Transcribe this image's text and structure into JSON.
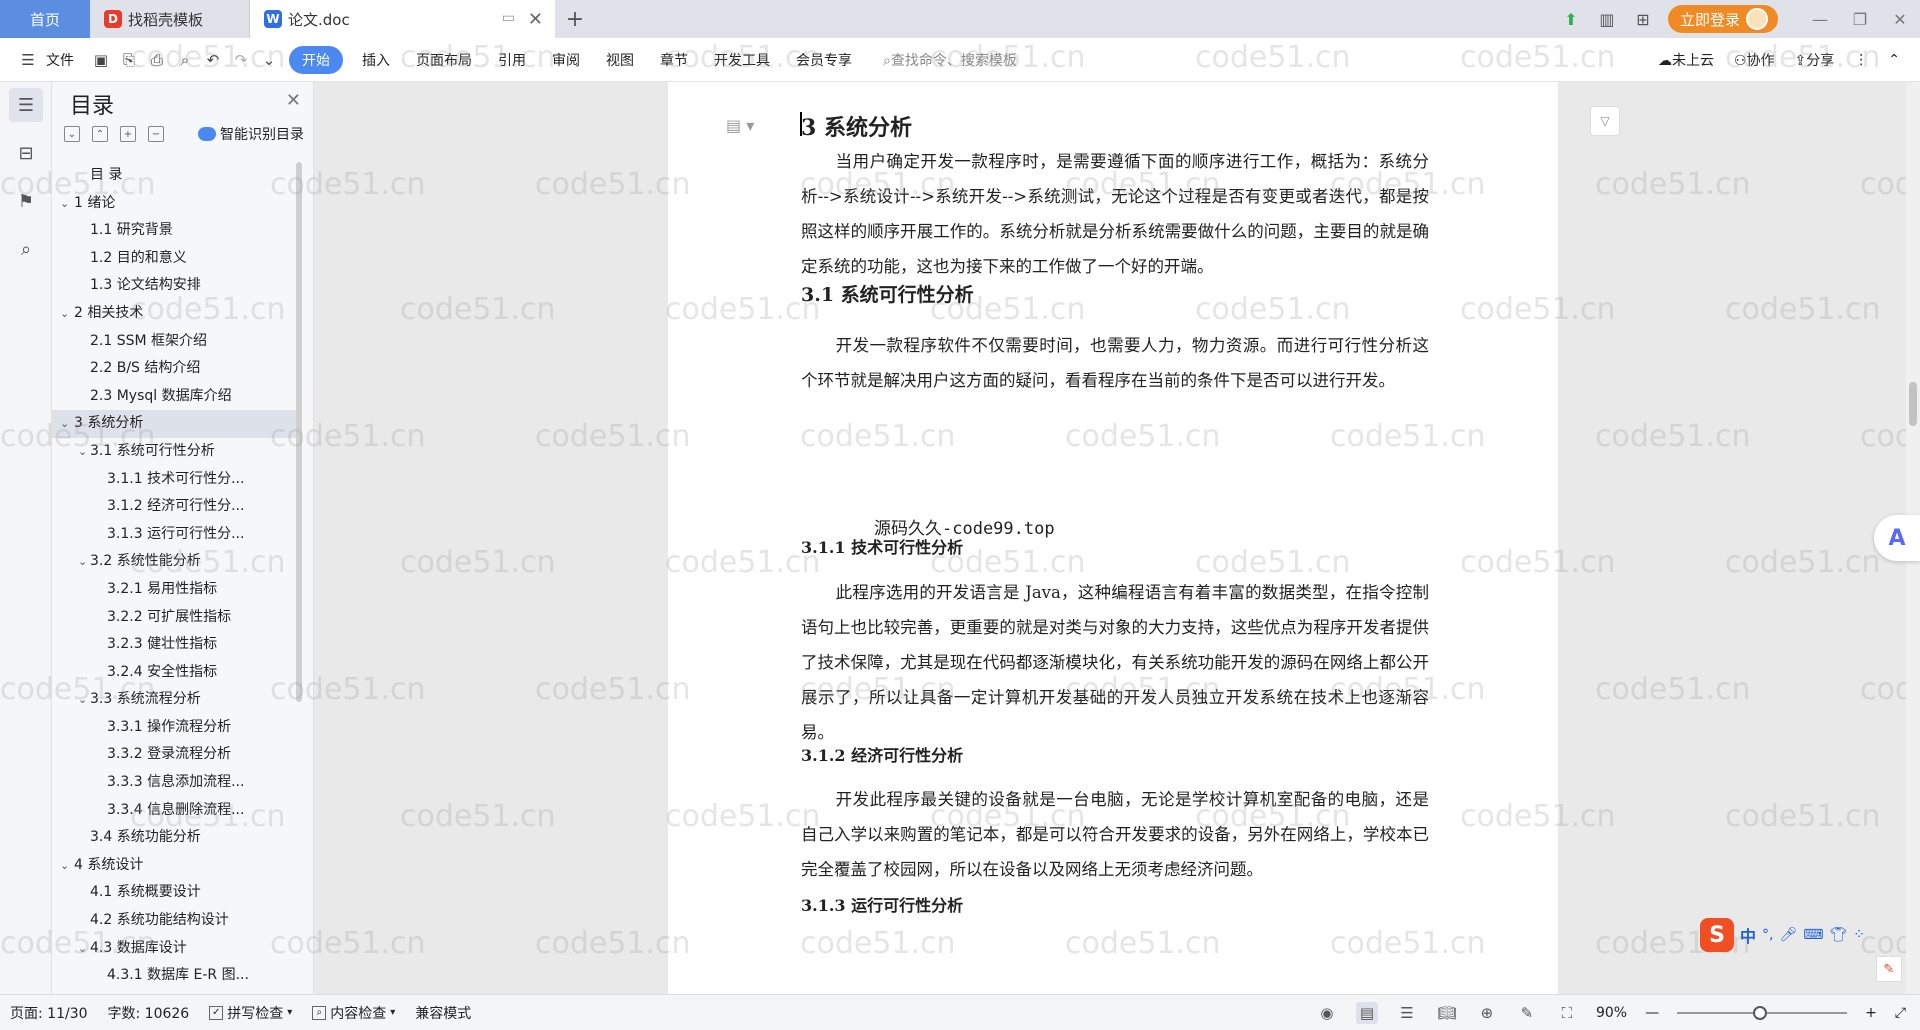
{
  "tabs": {
    "home": "首页",
    "template": "找稻壳模板",
    "doc": "论文.doc",
    "new_tab": "+"
  },
  "titlebar": {
    "login": "立即登录"
  },
  "menu": {
    "file": "文件",
    "items": [
      "开始",
      "插入",
      "页面布局",
      "引用",
      "审阅",
      "视图",
      "章节",
      "开发工具",
      "会员专享"
    ],
    "search_placeholder": "查找命令、搜索模板",
    "cloud": "未上云",
    "collab": "协作",
    "share": "分享"
  },
  "toc": {
    "title": "目录",
    "smart": "智能识别目录",
    "items": [
      {
        "text": "目 录",
        "level": 0,
        "arrow": ""
      },
      {
        "text": "1 绪论",
        "level": 1,
        "arrow": "v"
      },
      {
        "text": "1.1 研究背景",
        "level": 2,
        "arrow": ""
      },
      {
        "text": "1.2 目的和意义",
        "level": 2,
        "arrow": ""
      },
      {
        "text": "1.3 论文结构安排",
        "level": 2,
        "arrow": ""
      },
      {
        "text": "2 相关技术",
        "level": 1,
        "arrow": "v"
      },
      {
        "text": "2.1 SSM 框架介绍",
        "level": 2,
        "arrow": ""
      },
      {
        "text": "2.2 B/S 结构介绍",
        "level": 2,
        "arrow": ""
      },
      {
        "text": "2.3 Mysql 数据库介绍",
        "level": 2,
        "arrow": ""
      },
      {
        "text": "3 系统分析",
        "level": 1,
        "arrow": "v",
        "selected": true
      },
      {
        "text": "3.1 系统可行性分析",
        "level": 2,
        "arrow": "v"
      },
      {
        "text": "3.1.1 技术可行性分...",
        "level": 3,
        "arrow": ""
      },
      {
        "text": "3.1.2 经济可行性分...",
        "level": 3,
        "arrow": ""
      },
      {
        "text": "3.1.3 运行可行性分...",
        "level": 3,
        "arrow": ""
      },
      {
        "text": "3.2 系统性能分析",
        "level": 2,
        "arrow": "v"
      },
      {
        "text": "3.2.1 易用性指标",
        "level": 3,
        "arrow": ""
      },
      {
        "text": "3.2.2 可扩展性指标",
        "level": 3,
        "arrow": ""
      },
      {
        "text": "3.2.3 健壮性指标",
        "level": 3,
        "arrow": ""
      },
      {
        "text": "3.2.4 安全性指标",
        "level": 3,
        "arrow": ""
      },
      {
        "text": "3.3 系统流程分析",
        "level": 2,
        "arrow": "v"
      },
      {
        "text": "3.3.1 操作流程分析",
        "level": 3,
        "arrow": ""
      },
      {
        "text": "3.3.2 登录流程分析",
        "level": 3,
        "arrow": ""
      },
      {
        "text": "3.3.3 信息添加流程...",
        "level": 3,
        "arrow": ""
      },
      {
        "text": "3.3.4 信息删除流程...",
        "level": 3,
        "arrow": ""
      },
      {
        "text": "3.4 系统功能分析",
        "level": 2,
        "arrow": ""
      },
      {
        "text": "4 系统设计",
        "level": 1,
        "arrow": "v"
      },
      {
        "text": "4.1 系统概要设计",
        "level": 2,
        "arrow": ""
      },
      {
        "text": "4.2 系统功能结构设计",
        "level": 2,
        "arrow": ""
      },
      {
        "text": "4.3 数据库设计",
        "level": 2,
        "arrow": "v"
      },
      {
        "text": "4.3.1 数据库 E-R 图...",
        "level": 3,
        "arrow": ""
      }
    ]
  },
  "document": {
    "h1": "3  系统分析",
    "p1": "当用户确定开发一款程序时，是需要遵循下面的顺序进行工作，概括为：系统分析-->系统设计-->系统开发-->系统测试，无论这个过程是否有变更或者迭代，都是按照这样的顺序开展工作的。系统分析就是分析系统需要做什么的问题，主要目的就是确定系统的功能，这也为接下来的工作做了一个好的开端。",
    "h2_1": "3.1  系统可行性分析",
    "p2": "开发一款程序软件不仅需要时间，也需要人力，物力资源。而进行可行性分析这个环节就是解决用户这方面的疑问，看看程序在当前的条件下是否可以进行开发。",
    "overlay": "源码久久-code99.top",
    "h3_1": "3.1.1  技术可行性分析",
    "p3": "此程序选用的开发语言是 Java，这种编程语言有着丰富的数据类型，在指令控制语句上也比较完善，更重要的就是对类与对象的大力支持，这些优点为程序开发者提供了技术保障，尤其是现在代码都逐渐模块化，有关系统功能开发的源码在网络上都公开展示了，所以让具备一定计算机开发基础的开发人员独立开发系统在技术上也逐渐容易。",
    "h3_2": "3.1.2  经济可行性分析",
    "p4": "开发此程序最关键的设备就是一台电脑，无论是学校计算机室配备的电脑，还是自己入学以来购置的笔记本，都是可以符合开发要求的设备，另外在网络上，学校本已完全覆盖了校园网，所以在设备以及网络上无须考虑经济问题。",
    "h3_3": "3.1.3  运行可行性分析"
  },
  "watermark": "code51.cn",
  "ime": {
    "lang": "中"
  },
  "status": {
    "page": "页面: 11/30",
    "words": "字数: 10626",
    "spell": "拼写检查",
    "content": "内容检查",
    "compat": "兼容模式",
    "zoom": "90%"
  }
}
